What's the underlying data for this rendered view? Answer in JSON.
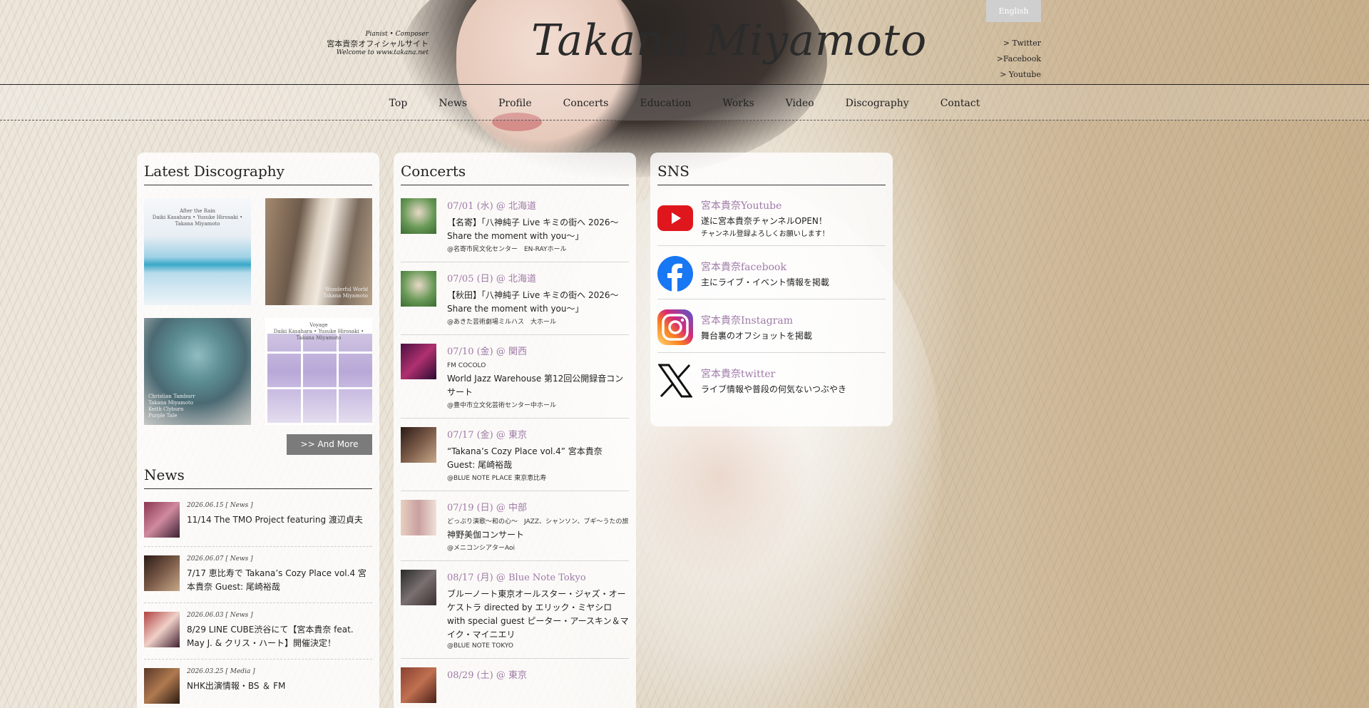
{
  "header": {
    "tagline": {
      "line1": "Pianist • Composer",
      "line2": "宮本貴奈オフィシャルサイト",
      "line3": "Welcome to www.takana.net"
    },
    "logo": "Takana Miyamoto",
    "lang_button": "English",
    "social_links": [
      "> Twitter",
      ">Facebook",
      "> Youtube"
    ]
  },
  "nav": {
    "items": [
      "Top",
      "News",
      "Profile",
      "Concerts",
      "Education",
      "Works",
      "Video",
      "Discography",
      "Contact"
    ]
  },
  "discography": {
    "title": "Latest Discography",
    "albums": [
      {
        "caption_top": "After the Rain",
        "caption_sub": "Daiki Kasahara • Yusuke Hirosaki • Takana Miyamoto",
        "caption_bottom": ""
      },
      {
        "caption_top": "",
        "caption_sub": "",
        "caption_bottom": "Wonderful World\nTakana Miyamoto"
      },
      {
        "caption_top": "",
        "caption_sub": "",
        "caption_bottom": "Christian Tamburr\nTakana Miyamoto\nKeith Clyburn\nPurple Tale"
      },
      {
        "caption_top": "Voyage",
        "caption_sub": "Daiki Kasahara • Yusuke Hirosaki • Takana Miyamoto",
        "caption_bottom": ""
      }
    ],
    "more_button": ">> And More"
  },
  "news": {
    "title": "News",
    "items": [
      {
        "meta": "2026.06.15 [ News ]",
        "text": "11/14 The TMO Project featuring 渡辺貞夫",
        "thumb_color": "#8a3550"
      },
      {
        "meta": "2026.06.07 [ News ]",
        "text": "7/17 恵比寿で Takana’s Cozy Place vol.4 宮本貴奈 Guest: 尾崎裕哉",
        "thumb_color": "#4a3028"
      },
      {
        "meta": "2026.06.03 [ News ]",
        "text": "8/29 LINE CUBE渋谷にて【宮本貴奈 feat. May J. & クリス・ハート】開催決定！",
        "thumb_color": "#b04040"
      },
      {
        "meta": "2026.03.25 [ Media ]",
        "text": "NHK出演情報・BS ＆ FM",
        "thumb_color": "#5a3828"
      }
    ]
  },
  "concerts": {
    "title": "Concerts",
    "items": [
      {
        "date": "07/01 (水) @ 北海道",
        "pre": "",
        "title": "【名寄】「八神純子 Live キミの街へ 2026〜Share the moment with you〜」",
        "venue": "@名寄市民文化センター　EN-RAYホール",
        "thumb_color": "#5f8a4e"
      },
      {
        "date": "07/05 (日) @ 北海道",
        "pre": "",
        "title": "【秋田】「八神純子 Live キミの街へ 2026〜Share the moment with you〜」",
        "venue": "@あきた芸術劇場ミルハス　大ホール",
        "thumb_color": "#5f8a4e"
      },
      {
        "date": "07/10 (金) @ 関西",
        "pre": "FM COCOLO",
        "title": "World Jazz Warehouse 第12回公開録音コンサート",
        "venue": "@豊中市立文化芸術センター中ホール",
        "thumb_color": "#6a2560"
      },
      {
        "date": "07/17 (金) @ 東京",
        "pre": "",
        "title": "“Takana’s Cozy Place vol.4” 宮本貴奈 Guest: 尾崎裕哉",
        "venue": "@BLUE NOTE PLACE 東京恵比寿",
        "thumb_color": "#4a3028"
      },
      {
        "date": "07/19 (日) @ 中部",
        "pre": "どっぷり演歌〜和の心〜　JAZZ、シャンソン、ブギ〜うたの旅",
        "title": "神野美伽コンサート",
        "venue": "@メニコンシアターAoi",
        "thumb_color": "#c8a890"
      },
      {
        "date": "08/17 (月) @ Blue Note Tokyo",
        "pre": "",
        "title": "ブルーノート東京オールスター・ジャズ・オーケストラ directed by エリック・ミヤシロ with special guest ピーター・アースキン＆マイク・マイニエリ",
        "venue": "@BLUE NOTE TOKYO",
        "thumb_color": "#3a3838"
      },
      {
        "date": "08/29 (土) @ 東京",
        "pre": "",
        "title": "",
        "venue": "",
        "thumb_color": "#8a4030"
      }
    ]
  },
  "sns": {
    "title": "SNS",
    "items": [
      {
        "name": "宮本貴奈Youtube",
        "desc": "遂に宮本貴奈チャンネルOPEN！",
        "sub": "チャンネル登録よろしくお願いします！",
        "icon": "youtube-icon",
        "color": "#e0161d"
      },
      {
        "name": "宮本貴奈facebook",
        "desc": "主にライブ・イベント情報を掲載",
        "sub": "",
        "icon": "facebook-icon",
        "color": "#1877f2"
      },
      {
        "name": "宮本貴奈Instagram",
        "desc": "舞台裏のオフショットを掲載",
        "sub": "",
        "icon": "instagram-icon",
        "color": "#d6249f"
      },
      {
        "name": "宮本貴奈twitter",
        "desc": "ライブ情報や普段の何気ないつぶやき",
        "sub": "",
        "icon": "x-icon",
        "color": "#111111"
      }
    ]
  },
  "colors": {
    "accent": "#a07aa8",
    "button_gray": "#7b7b7b"
  }
}
